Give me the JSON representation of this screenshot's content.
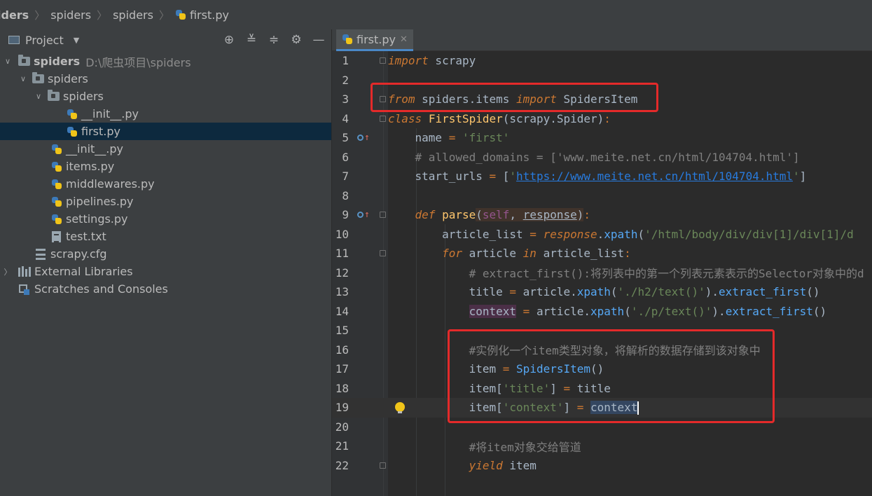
{
  "breadcrumb": {
    "items": [
      "iders",
      "spiders",
      "spiders",
      "first.py"
    ]
  },
  "project_panel": {
    "title": "Project",
    "tree": [
      {
        "label": "spiders",
        "path": "D:\\爬虫项目\\spiders",
        "type": "folder",
        "depth": 0,
        "expanded": true
      },
      {
        "label": "spiders",
        "type": "folder",
        "depth": 1,
        "expanded": true
      },
      {
        "label": "spiders",
        "type": "folder",
        "depth": 2,
        "expanded": true
      },
      {
        "label": "__init__.py",
        "type": "py",
        "depth": 3
      },
      {
        "label": "first.py",
        "type": "py",
        "depth": 3,
        "selected": true
      },
      {
        "label": "__init__.py",
        "type": "py",
        "depth": 2
      },
      {
        "label": "items.py",
        "type": "py",
        "depth": 2
      },
      {
        "label": "middlewares.py",
        "type": "py",
        "depth": 2
      },
      {
        "label": "pipelines.py",
        "type": "py",
        "depth": 2
      },
      {
        "label": "settings.py",
        "type": "py",
        "depth": 2
      },
      {
        "label": "test.txt",
        "type": "txt",
        "depth": 2
      },
      {
        "label": "scrapy.cfg",
        "type": "cfg",
        "depth": 1
      },
      {
        "label": "External Libraries",
        "type": "lib",
        "depth": 0
      },
      {
        "label": "Scratches and Consoles",
        "type": "scratch",
        "depth": 0
      }
    ]
  },
  "editor": {
    "tab_label": "first.py",
    "line_numbers": [
      "1",
      "2",
      "3",
      "4",
      "5",
      "6",
      "7",
      "8",
      "9",
      "10",
      "11",
      "12",
      "13",
      "14",
      "15",
      "16",
      "17",
      "18",
      "19",
      "20",
      "21",
      "22"
    ],
    "code": {
      "l1": [
        "import",
        " scrapy"
      ],
      "l3": [
        "from",
        " spiders.items ",
        "import",
        " SpidersItem"
      ],
      "l4": [
        "class",
        " ",
        "FirstSpider",
        "(scrapy.Spider)",
        ":"
      ],
      "l5": [
        "    name ",
        "=",
        " ",
        "'first'"
      ],
      "l6": "    # allowed_domains = ['www.meite.net.cn/html/104704.html']",
      "l7": [
        "    start_urls ",
        "=",
        " [",
        "'",
        "https://www.meite.net.cn/html/104704.html",
        "'",
        "]"
      ],
      "l9": [
        "    ",
        "def",
        " ",
        "parse",
        "(",
        "self",
        ", ",
        "response",
        ")",
        ":"
      ],
      "l10": [
        "        article_list ",
        "=",
        " ",
        "response",
        ".",
        "xpath",
        "(",
        "'/html/body/div/div[1]/div[1]/d"
      ],
      "l11": [
        "        ",
        "for",
        " article ",
        "in",
        " article_list",
        ":"
      ],
      "l12": "            # extract_first():将列表中的第一个列表元素表示的Selector对象中的d",
      "l13": [
        "            title ",
        "=",
        " article.",
        "xpath",
        "(",
        "'./h2/text()'",
        ").",
        "extract_first",
        "()"
      ],
      "l14": [
        "            ",
        "context",
        " ",
        "=",
        " article.",
        "xpath",
        "(",
        "'./p/text()'",
        ").",
        "extract_first",
        "()"
      ],
      "l16": "            #实例化一个item类型对象，将解析的数据存储到该对象中",
      "l17": [
        "            item ",
        "=",
        " ",
        "SpidersItem",
        "()"
      ],
      "l18": [
        "            item[",
        "'title'",
        "] ",
        "=",
        " title"
      ],
      "l19": [
        "            item[",
        "'context'",
        "] ",
        "=",
        " ",
        "context"
      ],
      "l21": "            #将item对象交给管道",
      "l22": [
        "            ",
        "yield",
        " item"
      ]
    }
  },
  "colors": {
    "annotation_box": "#e42a2a",
    "selection": "#0d293e",
    "tab_underline": "#4a88c7"
  }
}
